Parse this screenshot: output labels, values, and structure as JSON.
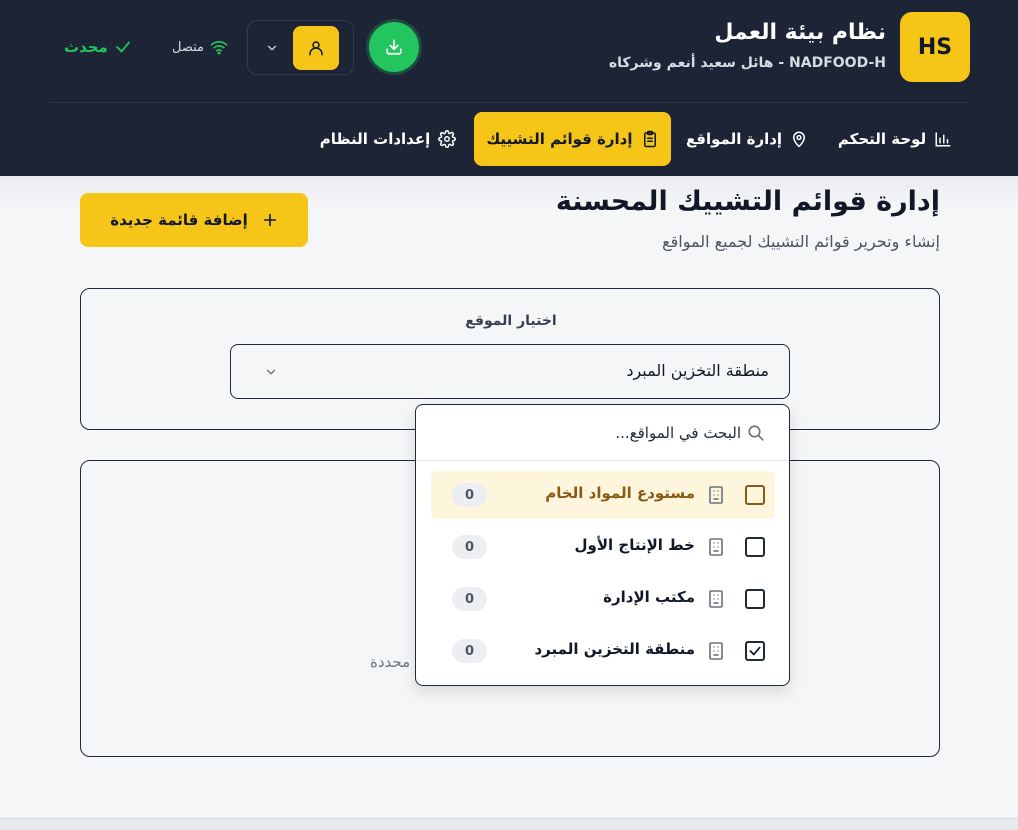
{
  "header": {
    "logo_text": "HS",
    "app_title": "نظام بيئة العمل",
    "app_subtitle": "NADFOOD-H - هائل سعيد أنعم وشركاه",
    "connection_status": "متصل",
    "sync_status": "محدث",
    "colors": {
      "background": "#1c2436",
      "accent": "#f5c518",
      "success": "#22c55e"
    }
  },
  "nav": {
    "items": [
      {
        "label": "لوحة التحكم",
        "icon": "bar-chart-icon",
        "active": false
      },
      {
        "label": "إدارة المواقع",
        "icon": "map-pin-icon",
        "active": false
      },
      {
        "label": "إدارة قوائم التشييك",
        "icon": "clipboard-icon",
        "active": true
      },
      {
        "label": "إعدادات النظام",
        "icon": "gear-icon",
        "active": false
      }
    ]
  },
  "page": {
    "title": "إدارة قوائم التشييك المحسنة",
    "subtitle": "إنشاء وتحرير قوائم التشييك لجميع المواقع",
    "add_button_label": "إضافة قائمة جديدة"
  },
  "site_selector": {
    "label": "اختيار الموقع",
    "selected_value": "منطقة التخزين المبرد"
  },
  "dropdown": {
    "search_placeholder": "البحث في المواقع...",
    "options": [
      {
        "label": "مستودع المواد الخام",
        "count": "0",
        "checked": false,
        "highlighted": true
      },
      {
        "label": "خط الإنتاج الأول",
        "count": "0",
        "checked": false,
        "highlighted": false
      },
      {
        "label": "مكتب الإدارة",
        "count": "0",
        "checked": false,
        "highlighted": false
      },
      {
        "label": "منطقة التخزين المبرد",
        "count": "0",
        "checked": true,
        "highlighted": false
      }
    ]
  },
  "content": {
    "empty_text_fragment": "محددة"
  }
}
